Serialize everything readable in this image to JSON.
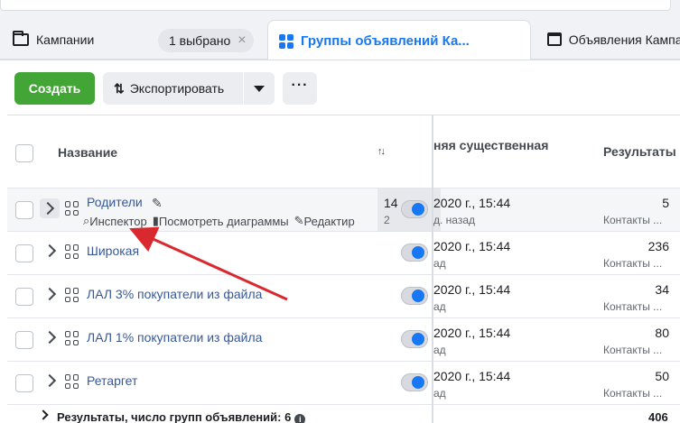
{
  "tabs": [
    {
      "label": "Кампании",
      "icon": "folder-icon"
    },
    {
      "label": "Группы объявлений Ка...",
      "icon": "grid-icon"
    },
    {
      "label": "Объявления Кампа",
      "icon": "window-icon"
    }
  ],
  "selection_chip": {
    "label": "1 выбрано",
    "close": "×"
  },
  "toolbar": {
    "create_label": "Создать",
    "export_label": "Экспортировать",
    "more_label": "···"
  },
  "columns": {
    "name": "Название",
    "sort": "↑↓",
    "delivery": "няя существенная",
    "results": "Результаты"
  },
  "rows": [
    {
      "name": "Родители",
      "date": "2020 г., 15:44",
      "ago": "д. назад",
      "overlay_day": "14",
      "overlay_ago": "2",
      "result": "5",
      "result_type": "Контакты ..."
    },
    {
      "name": "Широкая",
      "date": "2020 г., 15:44",
      "ago": "ад",
      "result": "236",
      "result_type": "Контакты ..."
    },
    {
      "name": "ЛАЛ 3% покупатели из файла",
      "date": "2020 г., 15:44",
      "ago": "ад",
      "result": "34",
      "result_type": "Контакты ..."
    },
    {
      "name": "ЛАЛ 1% покупатели из файла",
      "date": "2020 г., 15:44",
      "ago": "ад",
      "result": "80",
      "result_type": "Контакты ..."
    },
    {
      "name": "Ретаргет",
      "date": "2020 г., 15:44",
      "ago": "ад",
      "result": "50",
      "result_type": "Контакты ..."
    }
  ],
  "row_actions": {
    "inspector": "Инспектор",
    "charts": "Посмотреть диаграммы",
    "edit": "Редактир"
  },
  "footer": {
    "text": "Результаты, число групп объявлений: 6",
    "total": "406"
  },
  "colors": {
    "accent": "#1877f2",
    "create_button": "#42a535",
    "annotation_arrow": "#d9292e",
    "link": "#385898"
  }
}
